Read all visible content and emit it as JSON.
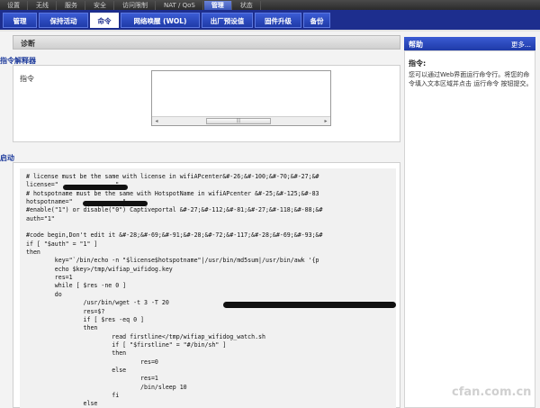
{
  "top_tabs": [
    "设置",
    "无线",
    "服务",
    "安全",
    "访问限制",
    "NAT / QoS",
    "管理",
    "状态"
  ],
  "top_tab_active": 6,
  "sub_tabs": [
    "管理",
    "保持活动",
    "命令",
    "网络唤醒 (WOL)",
    "出厂预设值",
    "固件升级",
    "备份"
  ],
  "sub_tab_active": 2,
  "section_title": "诊断",
  "interpreter": {
    "legend": "指令解释器",
    "label": "指令",
    "input_value": "",
    "scroll_arrow_left": "◂",
    "scroll_arrow_right": "▸",
    "scroll_thumb_grip": "|||"
  },
  "startup": {
    "legend": "启动",
    "code_lines": [
      "# license must be the same with license in wifiAPcenter&#-26;&#-100;&#-70;&#-27;&#",
      "license=\"                \"",
      "# hotspotname must be the same with HotspotName in wifiAPcenter &#-25;&#-125;&#-83",
      "hotspotname=\"              \"",
      "#enable(\"1\") or disable(\"0\") Captiveportal &#-27;&#-112;&#-81;&#-27;&#-118;&#-88;&#",
      "auth=\"1\"",
      "",
      "#code begin,Don't edit it &#-28;&#-69;&#-91;&#-28;&#-72;&#-117;&#-28;&#-69;&#-93;&#",
      "if [ \"$auth\" = \"1\" ]",
      "then",
      "        key=\"`/bin/echo -n \"$license$hotspotname\"|/usr/bin/md5sum|/usr/bin/awk '{p",
      "        echo $key>/tmp/wifiap_wifidog.key",
      "        res=1",
      "        while [ $res -ne 0 ]",
      "        do",
      "                /usr/bin/wget -t 3 -T 20",
      "                res=$?",
      "                if [ $res -eq 0 ]",
      "                then",
      "                        read firstline</tmp/wifiap_wifidog_watch.sh",
      "                        if [ \"$firstline\" = \"#/bin/sh\" ]",
      "                        then",
      "                                res=0",
      "                        else",
      "                                res=1",
      "                                /bin/sleep 10",
      "                        fi",
      "                else"
    ]
  },
  "help": {
    "title": "帮助",
    "more": "更多...",
    "subtitle": "指令:",
    "text": "您可以通过Web界面运行命令行。将您的命令填入文本区域并点击 运行命令 按钮提交。"
  },
  "watermark": "cfan.com.cn"
}
